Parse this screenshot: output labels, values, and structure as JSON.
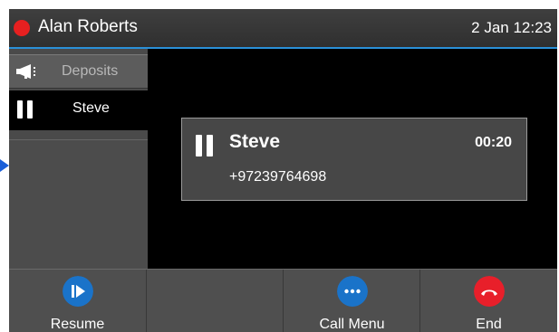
{
  "status_bar": {
    "user_name": "Alan Roberts",
    "datetime": "2 Jan 12:23",
    "presence_color": "#e62020"
  },
  "line_keys": [
    {
      "label": "Deposits",
      "icon": "megaphone-icon"
    },
    {
      "label": "Steve",
      "icon": "pause-icon"
    }
  ],
  "call": {
    "name": "Steve",
    "number": "+97239764698",
    "duration": "00:20",
    "state_icon": "pause-icon"
  },
  "softkeys": [
    {
      "label": "Resume",
      "icon": "play-icon",
      "color": "#1a73c9"
    },
    {
      "label": "",
      "icon": ""
    },
    {
      "label": "Call Menu",
      "icon": "ellipsis-icon",
      "color": "#1a73c9"
    },
    {
      "label": "End",
      "icon": "hangup-icon",
      "color": "#e81f2a"
    }
  ],
  "colors": {
    "accent": "#2a90d8",
    "background": "#000000"
  }
}
